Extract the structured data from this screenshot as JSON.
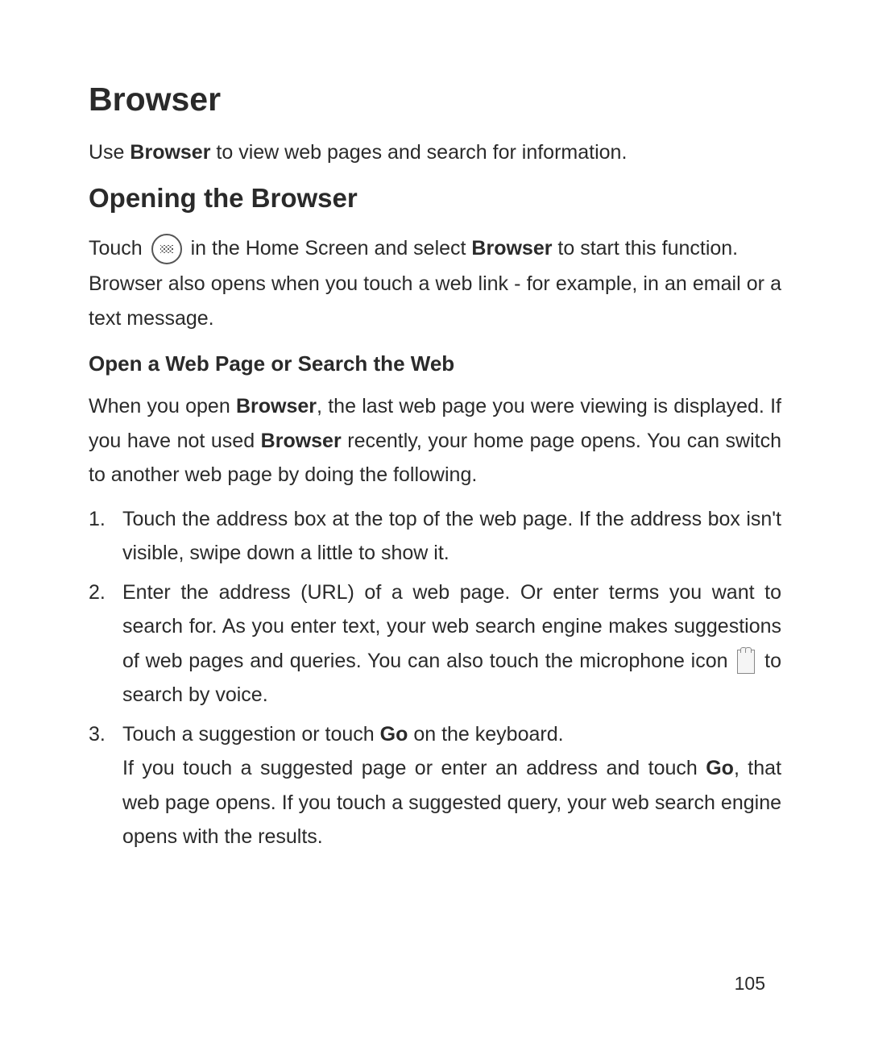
{
  "title": "Browser",
  "intro": {
    "prefix": "Use ",
    "bold1": "Browser",
    "suffix": " to view web pages and search for information."
  },
  "section1": {
    "heading": "Opening the Browser",
    "para1": {
      "part1": "Touch ",
      "part2": " in the Home Screen and select ",
      "bold1": "Browser",
      "part3": " to start this function."
    },
    "para2": "Browser also opens when you touch a web link - for example, in an email or a text message."
  },
  "section2": {
    "heading": "Open a Web Page or Search the Web",
    "para1": {
      "part1": "When you open ",
      "bold1": "Browser",
      "part2": ", the last web page you were viewing is displayed. If you have not used ",
      "bold2": "Browser",
      "part3": " recently, your home page opens. You can switch to another web page by doing the following."
    },
    "list": {
      "item1": "Touch the address box at the top of the web page. If the address box isn't visible, swipe down a little to show it.",
      "item2": {
        "part1": "Enter the address (URL) of a web page. Or enter terms you want to search for. As you enter text, your web search engine makes suggestions of web pages and queries. You can also touch the microphone icon ",
        "part2": " to search by voice."
      },
      "item3": {
        "part1": "Touch a suggestion or touch ",
        "bold1": "Go",
        "part2": " on the keyboard.",
        "part3": "If you touch a suggested page or enter an address and touch ",
        "bold2": "Go",
        "part4": ", that web page opens. If you touch a suggested query, your web search engine opens with the results."
      }
    }
  },
  "page_number": "105"
}
